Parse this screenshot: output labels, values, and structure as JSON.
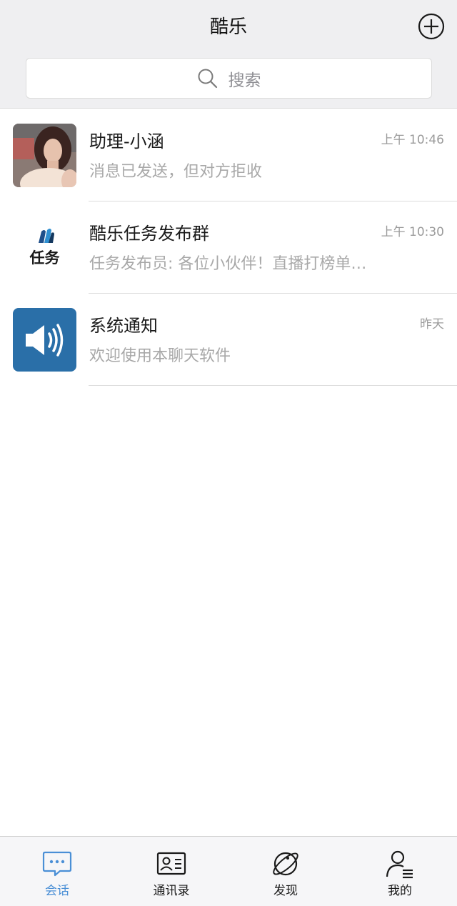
{
  "header": {
    "title": "酷乐"
  },
  "search": {
    "placeholder": "搜索"
  },
  "conversations": [
    {
      "name": "助理-小涵",
      "time": "上午 10:46",
      "message": "消息已发送，但对方拒收",
      "avatar": "photo-avatar"
    },
    {
      "name": "酷乐任务发布群",
      "time": "上午 10:30",
      "message": "任务发布员: 各位小伙伴！直播打榜单…",
      "avatar": "task-logo",
      "avatar_text": "任务"
    },
    {
      "name": "系统通知",
      "time": "昨天",
      "message": "欢迎使用本聊天软件",
      "avatar": "speaker-icon"
    }
  ],
  "tabs": [
    {
      "label": "会话",
      "icon": "chat-bubble-icon",
      "active": true
    },
    {
      "label": "通讯录",
      "icon": "contact-card-icon",
      "active": false
    },
    {
      "label": "发现",
      "icon": "planet-icon",
      "active": false
    },
    {
      "label": "我的",
      "icon": "user-profile-icon",
      "active": false
    }
  ],
  "colors": {
    "accent": "#4a8fd6",
    "system_blue": "#2a6fa8",
    "header_bg": "#efeff1"
  }
}
